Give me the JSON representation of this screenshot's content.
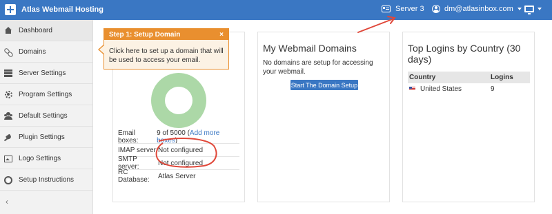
{
  "app": {
    "title": "Atlas Webmail Hosting",
    "logo_icon": "plus-square-icon"
  },
  "topbar": {
    "server_label": "Server 3",
    "server_icon": "id-card-icon",
    "user_email": "dm@atlasinbox.com",
    "user_icon": "user-circle-icon",
    "monitor_icon": "monitor-icon",
    "background": "#3a77c3"
  },
  "sidebar": {
    "items": [
      {
        "label": "Dashboard",
        "icon": "home-icon",
        "active": true
      },
      {
        "label": "Domains",
        "icon": "link-icon"
      },
      {
        "label": "Server Settings",
        "icon": "server-icon"
      },
      {
        "label": "Program Settings",
        "icon": "gear-icon"
      },
      {
        "label": "Default Settings",
        "icon": "users-icon"
      },
      {
        "label": "Plugin Settings",
        "icon": "plug-icon"
      },
      {
        "label": "Logo Settings",
        "icon": "image-icon"
      },
      {
        "label": "Setup Instructions",
        "icon": "life-ring-icon"
      }
    ],
    "collapse_glyph": "‹"
  },
  "popover": {
    "title": "Step 1: Setup Domain",
    "close_glyph": "×",
    "body": "Click here to set up a domain that will be used to access your email.",
    "color": "#e98f2f"
  },
  "overview": {
    "donut_color": "#acd8a7",
    "rows": [
      {
        "label": "Email boxes:",
        "value": "9 of 5000",
        "link": "Add more boxes"
      },
      {
        "label": "IMAP server:",
        "value": "Not configured"
      },
      {
        "label": "SMTP server:",
        "value": "Not configured"
      },
      {
        "label": "RC Database:",
        "value": "Atlas Server"
      }
    ]
  },
  "domains_panel": {
    "title": "My Webmail Domains",
    "note": "No domains are setup for accessing your webmail.",
    "button": "Start The Domain Setup"
  },
  "logins_panel": {
    "title": "Top Logins by Country (30 days)",
    "columns": [
      "Country",
      "Logins"
    ],
    "rows": [
      {
        "country": "United States",
        "logins": "9"
      }
    ]
  },
  "annotations": {
    "color": "#e0483a"
  }
}
